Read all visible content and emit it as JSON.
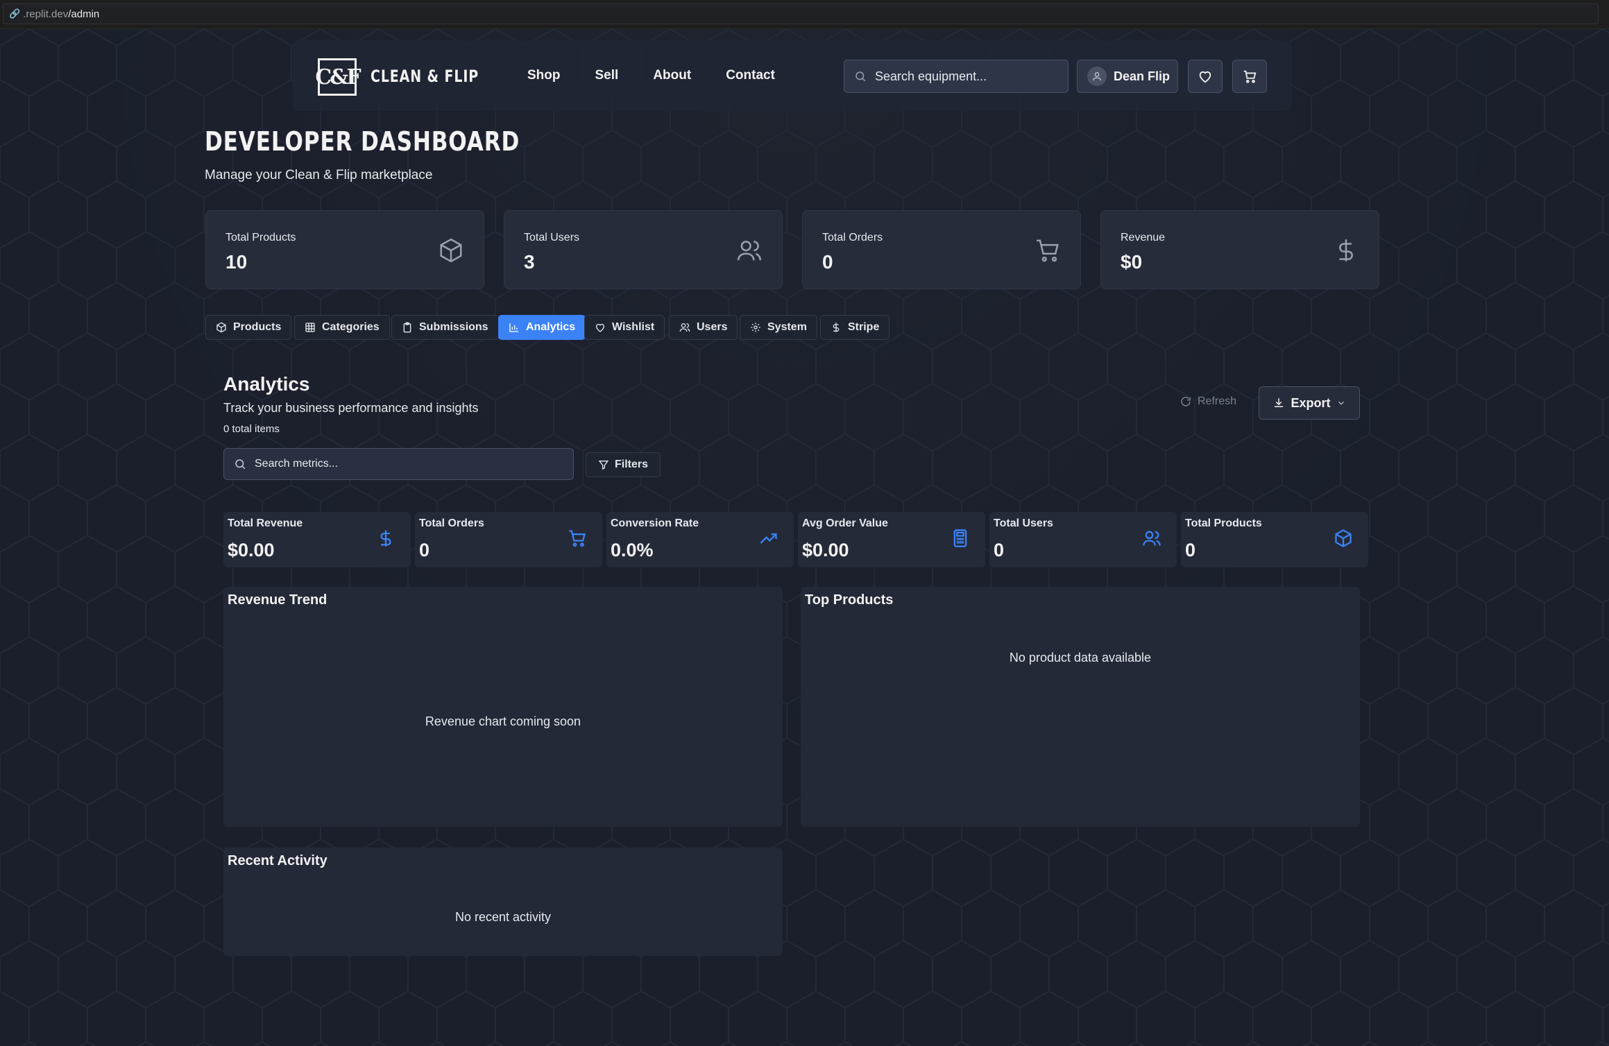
{
  "browser": {
    "url_host": ".replit.dev",
    "url_path": "/admin"
  },
  "header": {
    "logo_text": "C&F",
    "brand": "CLEAN & FLIP",
    "nav": [
      "Shop",
      "Sell",
      "About",
      "Contact"
    ],
    "search_placeholder": "Search equipment...",
    "user_name": "Dean Flip"
  },
  "page": {
    "title": "DEVELOPER DASHBOARD",
    "subtitle": "Manage your Clean & Flip marketplace"
  },
  "stats": [
    {
      "label": "Total Products",
      "value": "10",
      "icon": "box-icon"
    },
    {
      "label": "Total Users",
      "value": "3",
      "icon": "users-icon"
    },
    {
      "label": "Total Orders",
      "value": "0",
      "icon": "cart-icon"
    },
    {
      "label": "Revenue",
      "value": "$0",
      "icon": "dollar-icon"
    }
  ],
  "tabs": [
    {
      "label": "Products",
      "icon": "box-icon",
      "active": false
    },
    {
      "label": "Categories",
      "icon": "grid-icon",
      "active": false
    },
    {
      "label": "Submissions",
      "icon": "clipboard-icon",
      "active": false
    },
    {
      "label": "Analytics",
      "icon": "bar-chart-icon",
      "active": true
    },
    {
      "label": "Wishlist",
      "icon": "heart-icon",
      "active": false
    },
    {
      "label": "Users",
      "icon": "users-icon",
      "active": false
    },
    {
      "label": "System",
      "icon": "gear-icon",
      "active": false
    },
    {
      "label": "Stripe",
      "icon": "dollar-icon",
      "active": false
    }
  ],
  "analytics": {
    "title": "Analytics",
    "subtitle": "Track your business performance and insights",
    "count": "0 total items",
    "refresh_label": "Refresh",
    "export_label": "Export",
    "search_placeholder": "Search metrics...",
    "filters_label": "Filters",
    "metrics": [
      {
        "label": "Total Revenue",
        "value": "$0.00",
        "icon": "dollar-icon"
      },
      {
        "label": "Total Orders",
        "value": "0",
        "icon": "cart-icon"
      },
      {
        "label": "Conversion Rate",
        "value": "0.0%",
        "icon": "trending-up-icon"
      },
      {
        "label": "Avg Order Value",
        "value": "$0.00",
        "icon": "calculator-icon"
      },
      {
        "label": "Total Users",
        "value": "0",
        "icon": "users-icon"
      },
      {
        "label": "Total Products",
        "value": "0",
        "icon": "box-icon"
      }
    ],
    "revenue_trend": {
      "title": "Revenue Trend",
      "empty": "Revenue chart coming soon"
    },
    "top_products": {
      "title": "Top Products",
      "empty": "No product data available"
    },
    "recent_activity": {
      "title": "Recent Activity",
      "empty": "No recent activity"
    }
  },
  "colors": {
    "accent": "#3b82f6",
    "background": "#1a1f2b",
    "card": "#262c3a"
  }
}
